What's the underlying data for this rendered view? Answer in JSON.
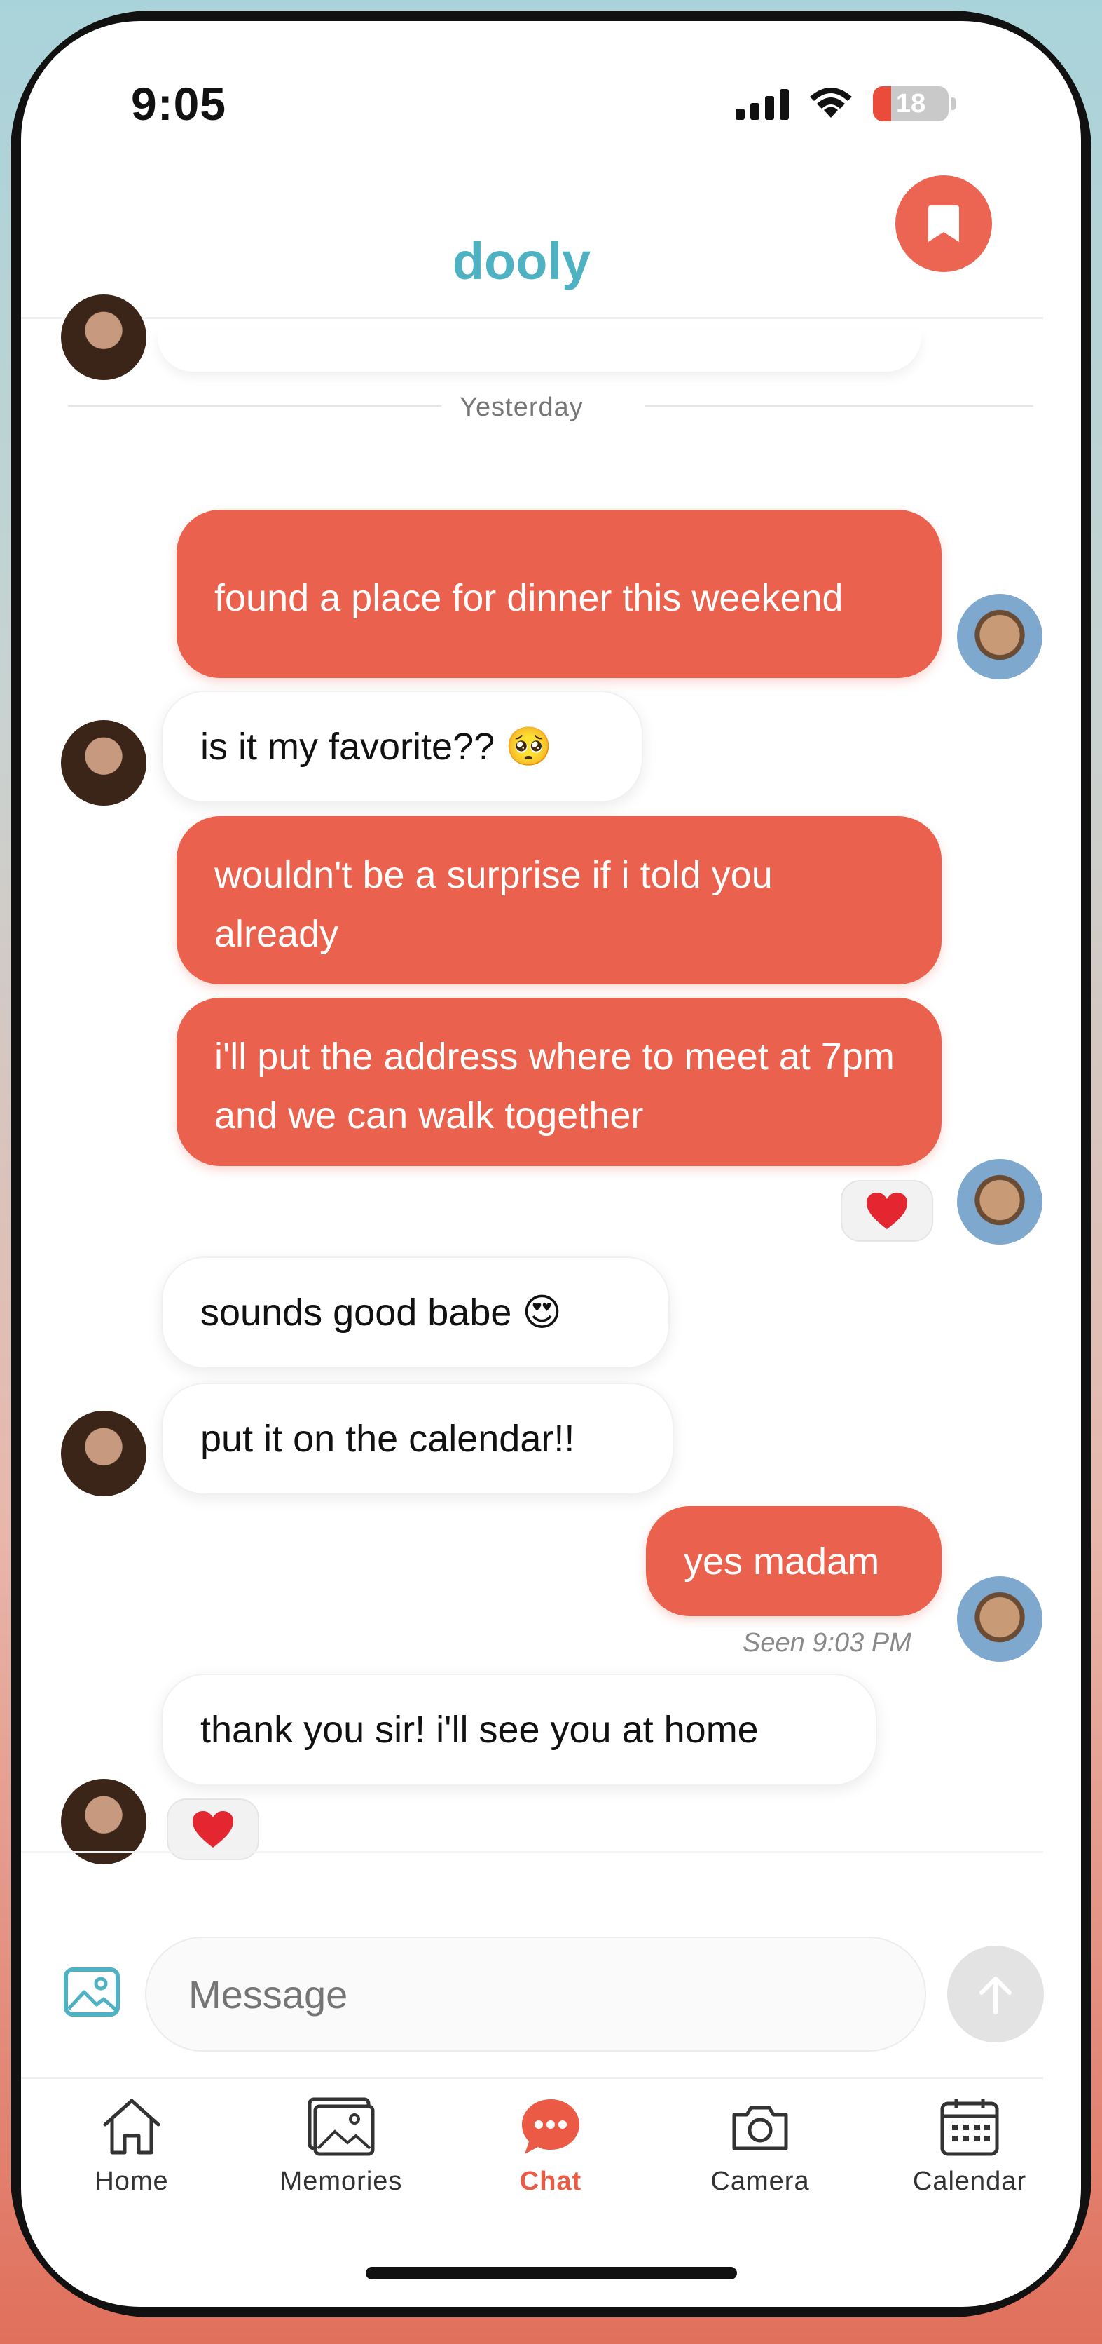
{
  "status_bar": {
    "time": "9:05",
    "battery": "18"
  },
  "header": {
    "title": "dooly"
  },
  "conversation": {
    "day_separator": "Yesterday",
    "messages": [
      {
        "from": "me",
        "text": "found a place for dinner this weekend"
      },
      {
        "from": "partner",
        "text": "is it my favorite?? 🥺"
      },
      {
        "from": "me",
        "text": "wouldn't be a surprise if i told you already"
      },
      {
        "from": "me",
        "text": "i'll put the address where to meet at 7pm and we can walk together"
      },
      {
        "from": "partner",
        "text": "sounds good babe 😍"
      },
      {
        "from": "partner",
        "text": "put it on the calendar!!"
      },
      {
        "from": "me",
        "text": "yes madam"
      },
      {
        "from": "partner",
        "text": "thank you sir! i'll see you at home"
      }
    ],
    "reactions": [
      "❤️",
      "❤️"
    ],
    "seen_status": "Seen 9:03 PM"
  },
  "composer": {
    "placeholder": "Message"
  },
  "tab_bar": {
    "tabs": [
      {
        "label": "Home",
        "icon": "home-icon"
      },
      {
        "label": "Memories",
        "icon": "photos-icon"
      },
      {
        "label": "Chat",
        "icon": "chat-icon",
        "active": true
      },
      {
        "label": "Camera",
        "icon": "camera-icon"
      },
      {
        "label": "Calendar",
        "icon": "calendar-icon"
      }
    ]
  },
  "colors": {
    "accent": "#ea624e",
    "brand": "#4fb2c2"
  }
}
